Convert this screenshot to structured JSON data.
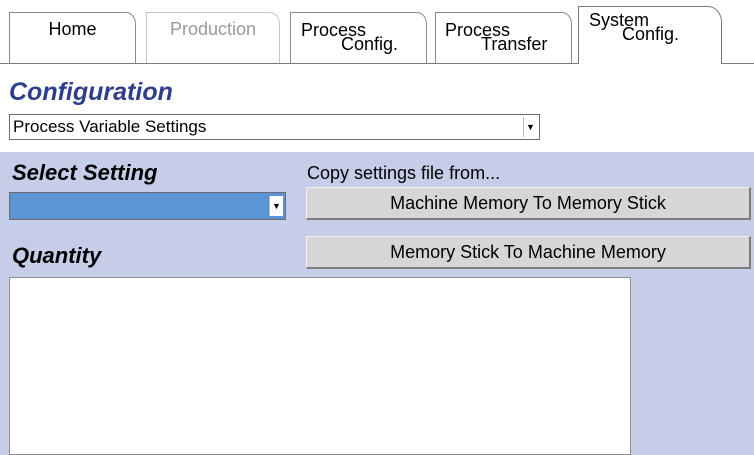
{
  "tabs": [
    {
      "id": "home",
      "line1": "Home",
      "line2": "",
      "state": "normal"
    },
    {
      "id": "production",
      "line1": "Production",
      "line2": "",
      "state": "disabled"
    },
    {
      "id": "process-config",
      "line1": "Process",
      "line2": "Config.",
      "state": "normal"
    },
    {
      "id": "process-transfer",
      "line1": "Process",
      "line2": "Transfer",
      "state": "normal"
    },
    {
      "id": "system-config",
      "line1": "System",
      "line2": "Config.",
      "state": "active"
    }
  ],
  "configuration": {
    "title": "Configuration",
    "selected": "Process Variable Settings"
  },
  "panel": {
    "select_setting_label": "Select Setting",
    "setting_value": "",
    "copy_label": "Copy settings file from...",
    "btn_machine_to_stick": "Machine Memory To Memory Stick",
    "btn_stick_to_machine": "Memory Stick To Machine Memory",
    "quantity_label": "Quantity",
    "quantity_value": ""
  },
  "colors": {
    "title": "#2f3d8e",
    "panel_bg": "#c5cde8",
    "selected_highlight": "#5b95d6",
    "button_bg": "#d6d6d6"
  },
  "icons": {
    "dropdown": "chevron-down-icon"
  }
}
